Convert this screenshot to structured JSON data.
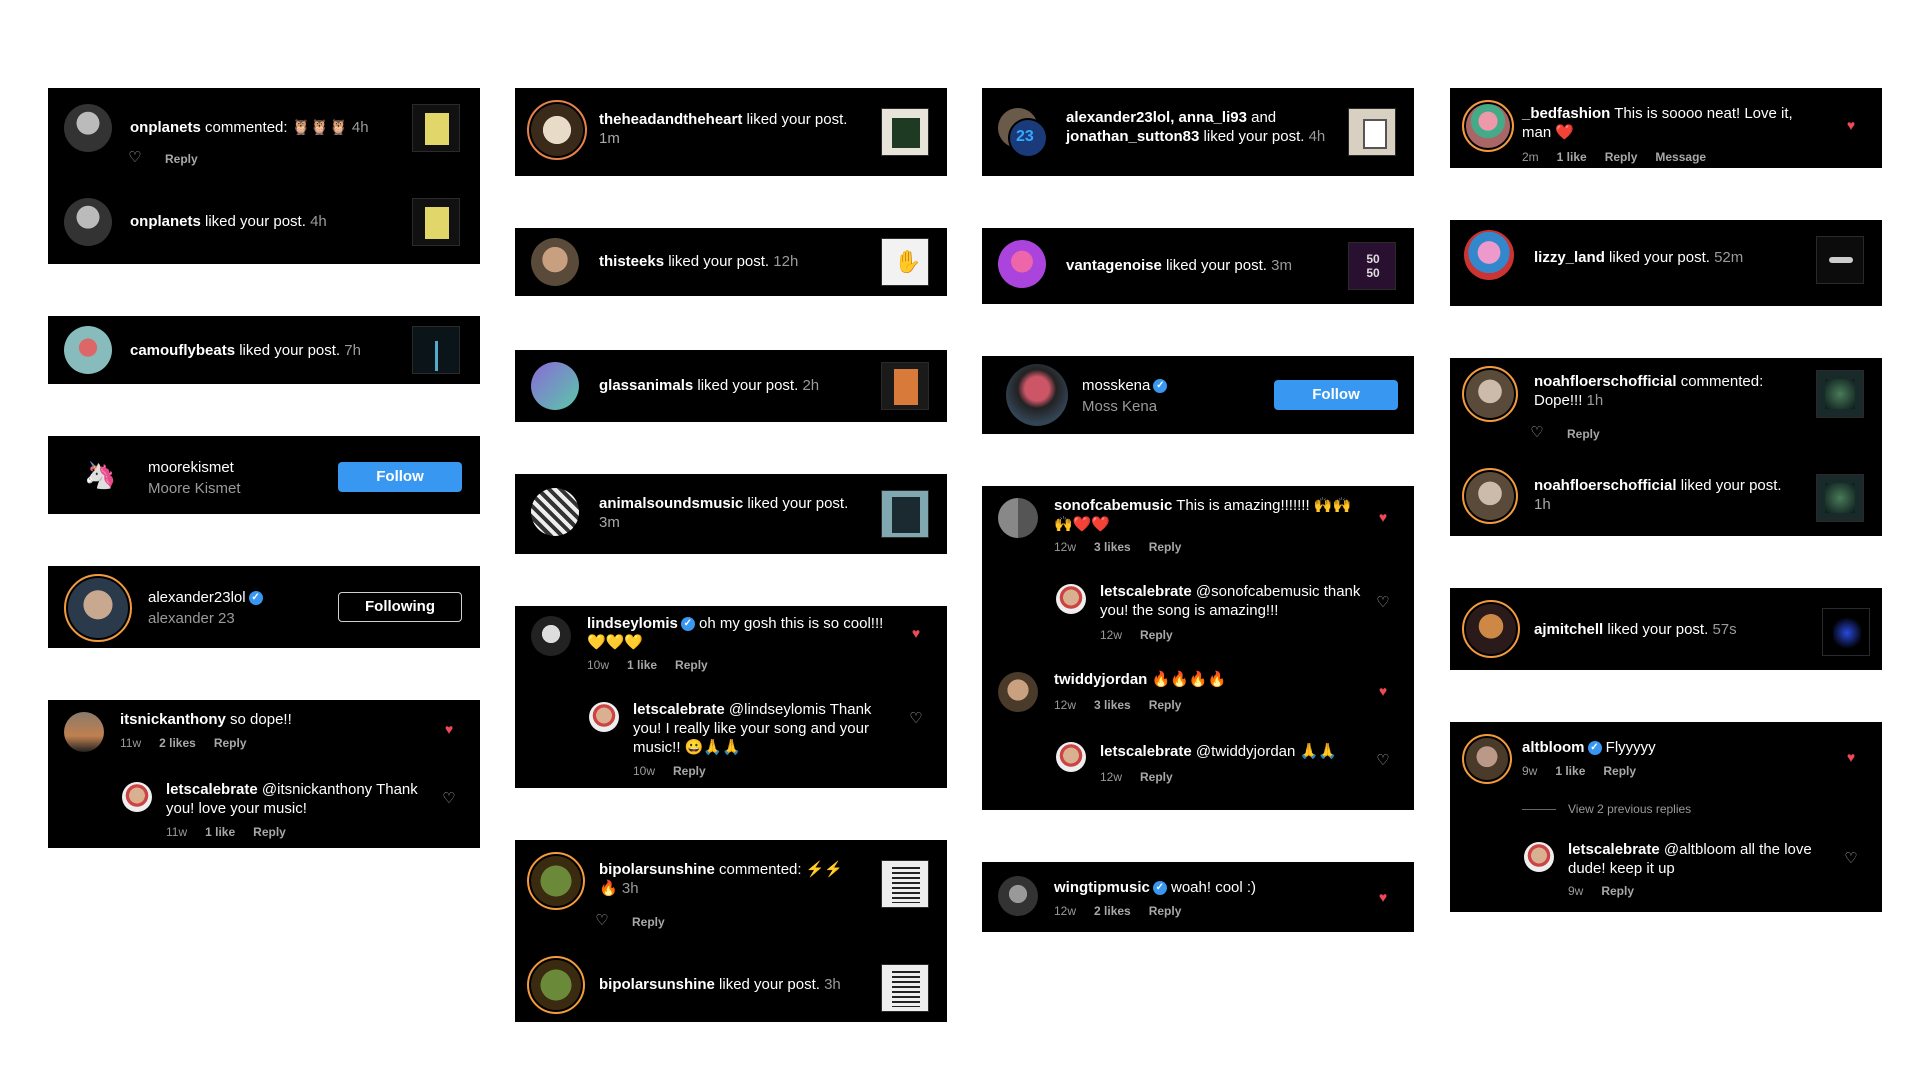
{
  "col1": {
    "c1": {
      "r1": {
        "user": "onplanets",
        "action": " commented: ",
        "text": "🦉🦉🦉",
        "time": "4h",
        "reply": "Reply"
      },
      "r2": {
        "user": "onplanets",
        "action": " liked your post.",
        "time": "4h"
      }
    },
    "c2": {
      "user": "camouflybeats",
      "action": " liked your post.",
      "time": "7h"
    },
    "c3": {
      "user": "moorekismet",
      "name": "Moore Kismet",
      "button": "Follow"
    },
    "c4": {
      "user": "alexander23lol",
      "name": "alexander 23",
      "button": "Following"
    },
    "c5": {
      "r1": {
        "user": "itsnickanthony",
        "text": " so dope!!",
        "time": "11w",
        "likes": "2 likes",
        "reply": "Reply"
      },
      "r2": {
        "user": "letscalebrate",
        "text": " @itsnickanthony Thank you! love your music!",
        "time": "11w",
        "likes": "1 like",
        "reply": "Reply"
      }
    }
  },
  "col2": {
    "c1": {
      "user": "theheadandtheheart",
      "action": " liked your post.",
      "time": "1m"
    },
    "c2": {
      "user": "thisteeks",
      "action": " liked your post.",
      "time": "12h"
    },
    "c3": {
      "user": "glassanimals",
      "action": " liked your post.",
      "time": "2h"
    },
    "c4": {
      "user": "animalsoundsmusic",
      "action": " liked your post.",
      "time": "3m"
    },
    "c5": {
      "r1": {
        "user": "lindseylomis",
        "text": " oh my gosh this is so cool!!! 💛💛💛",
        "time": "10w",
        "likes": "1 like",
        "reply": "Reply"
      },
      "r2": {
        "user": "letscalebrate",
        "text": " @lindseylomis Thank you! I really like your song and your music!! 😀🙏🙏",
        "time": "10w",
        "reply": "Reply"
      }
    },
    "c6": {
      "r1": {
        "user": "bipolarsunshine",
        "action": " commented: ",
        "text": "⚡⚡🔥",
        "time": "3h",
        "reply": "Reply"
      },
      "r2": {
        "user": "bipolarsunshine",
        "action": " liked your post.",
        "time": "3h"
      }
    }
  },
  "col3": {
    "c1": {
      "users": "alexander23lol, anna_li93",
      "and": " and ",
      "user3": "jonathan_sutton83",
      "action": " liked your post.",
      "time": "4h"
    },
    "c2": {
      "user": "vantagenoise",
      "action": " liked your post.",
      "time": "3m",
      "thumb": "50 50"
    },
    "c3": {
      "user": "mosskena",
      "name": "Moss Kena",
      "button": "Follow"
    },
    "c4": {
      "r1": {
        "user": "sonofcabemusic",
        "text": " This is amazing!!!!!!! 🙌🙌🙌❤️❤️",
        "time": "12w",
        "likes": "3 likes",
        "reply": "Reply"
      },
      "r2": {
        "user": "letscalebrate",
        "text": " @sonofcabemusic thank you! the song is amazing!!!",
        "time": "12w",
        "reply": "Reply"
      },
      "r3": {
        "user": "twiddyjordan",
        "text": " 🔥🔥🔥🔥",
        "time": "12w",
        "likes": "3 likes",
        "reply": "Reply"
      },
      "r4": {
        "user": "letscalebrate",
        "text": " @twiddyjordan 🙏🙏",
        "time": "12w",
        "reply": "Reply"
      }
    },
    "c5": {
      "user": "wingtipmusic",
      "text": " woah! cool :)",
      "time": "12w",
      "likes": "2 likes",
      "reply": "Reply"
    }
  },
  "col4": {
    "c1": {
      "user": "_bedfashion",
      "text": " This is soooo neat! Love it, man ❤️",
      "time": "2m",
      "likes": "1 like",
      "reply": "Reply",
      "message": "Message"
    },
    "c2": {
      "user": "lizzy_land",
      "action": " liked your post.",
      "time": "52m"
    },
    "c3": {
      "r1": {
        "user": "noahfloerschofficial",
        "action": " commented:",
        "text": "Dope!!!",
        "time": "1h",
        "reply": "Reply"
      },
      "r2": {
        "user": "noahfloerschofficial",
        "action": " liked your post.",
        "time": "1h"
      }
    },
    "c4": {
      "user": "ajmitchell",
      "action": " liked your post.",
      "time": "57s"
    },
    "c5": {
      "r1": {
        "user": "altbloom",
        "text": " Flyyyyy",
        "time": "9w",
        "likes": "1 like",
        "reply": "Reply"
      },
      "viewprev": "View 2 previous replies",
      "r2": {
        "user": "letscalebrate",
        "text": " @altbloom all the love dude! keep it up",
        "time": "9w",
        "reply": "Reply"
      }
    }
  },
  "colors": {
    "bg": "#ffffff",
    "card": "#000000",
    "accent": "#3897f0",
    "heart": "#ed4956"
  }
}
